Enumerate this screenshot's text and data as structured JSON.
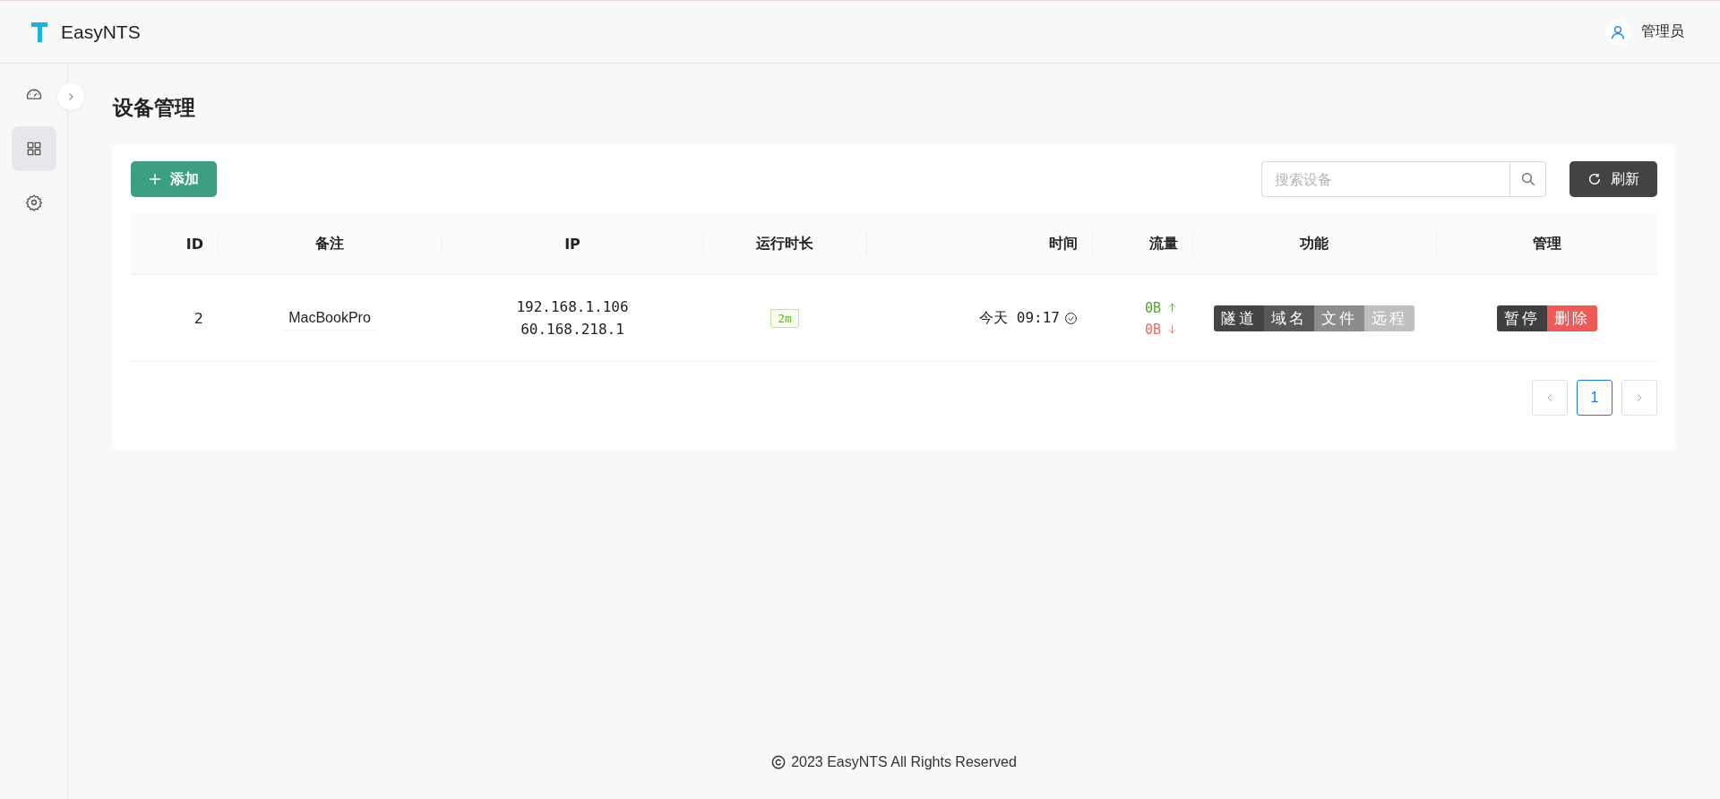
{
  "header": {
    "brand": "EasyNTS",
    "user": "管理员"
  },
  "sidebar": {
    "items": [
      {
        "kind": "dashboard",
        "selected": false
      },
      {
        "kind": "grid",
        "selected": true
      },
      {
        "kind": "settings",
        "selected": false
      }
    ]
  },
  "page_title": "设备管理",
  "toolbar": {
    "add_button": "添加",
    "search": {
      "placeholder": "搜索设备"
    },
    "refresh_button": "刷新"
  },
  "table": {
    "columns": [
      "ID",
      "备注",
      "IP",
      "运行时长",
      "时间",
      "流量",
      "功能",
      "管理"
    ],
    "rows": [
      {
        "id": "2",
        "note": "MacBookPro",
        "ips": [
          "192.168.1.106",
          "60.168.218.1"
        ],
        "uptime": "2m",
        "time": "今天 09:17",
        "traffic": [
          {
            "kind": "up",
            "text": "0B"
          },
          {
            "kind": "down",
            "text": "0B"
          }
        ],
        "features": [
          {
            "label": "隧道",
            "color": "#444444"
          },
          {
            "label": "域名",
            "color": "#595959"
          },
          {
            "label": "文件",
            "color": "#8c8c8c"
          },
          {
            "label": "远程",
            "color": "#bfbfbf"
          }
        ],
        "actions": [
          {
            "label": "暂停",
            "color": "#3f3f3f"
          },
          {
            "label": "删除",
            "color": "#f05a56"
          }
        ]
      }
    ]
  },
  "pagination": {
    "pages": [
      {
        "label": "1",
        "selected": true
      }
    ]
  },
  "footer": "2023 EasyNTS All Rights Reserved"
}
